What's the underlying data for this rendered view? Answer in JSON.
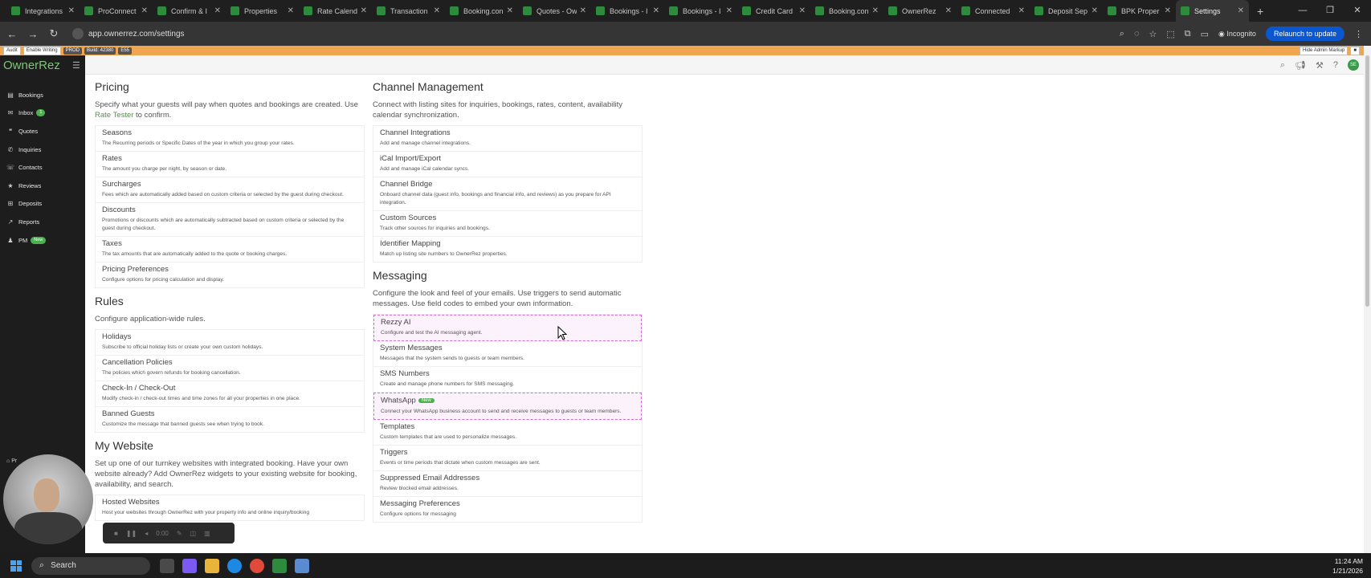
{
  "browser": {
    "tabs": [
      {
        "label": "Integrations"
      },
      {
        "label": "ProConnect"
      },
      {
        "label": "Confirm & I"
      },
      {
        "label": "Properties"
      },
      {
        "label": "Rate Calend"
      },
      {
        "label": "Transaction"
      },
      {
        "label": "Booking.con"
      },
      {
        "label": "Quotes - Ow"
      },
      {
        "label": "Bookings - I"
      },
      {
        "label": "Bookings - I"
      },
      {
        "label": "Credit Card"
      },
      {
        "label": "Booking.con"
      },
      {
        "label": "OwnerRez"
      },
      {
        "label": "Connected"
      },
      {
        "label": "Deposit Sep"
      },
      {
        "label": "BPK Proper"
      },
      {
        "label": "Settings"
      }
    ],
    "url": "app.ownerrez.com/settings",
    "incognito_label": "Incognito",
    "relaunch_label": "Relaunch to update"
  },
  "toolbar": {
    "audit_label": "Audit",
    "enable_writing_label": "Enable Writing",
    "env_badge": "PROD",
    "build_badge": "Build: 42380",
    "extra_badge": "E55",
    "hide_admin_label": "Hide Admin Markup"
  },
  "app": {
    "logo": "OwnerRez",
    "avatar_initials": "SE",
    "nav": [
      {
        "label": "Bookings",
        "icon": "book-icon"
      },
      {
        "label": "Inbox",
        "icon": "inbox-icon",
        "badge": "1"
      },
      {
        "label": "Quotes",
        "icon": "quotes-icon"
      },
      {
        "label": "Inquiries",
        "icon": "inquiries-icon"
      },
      {
        "label": "Contacts",
        "icon": "contacts-icon"
      },
      {
        "label": "Reviews",
        "icon": "star-icon"
      },
      {
        "label": "Deposits",
        "icon": "deposits-icon"
      },
      {
        "label": "Reports",
        "icon": "reports-icon"
      },
      {
        "label": "PM",
        "icon": "user-icon",
        "badge": "New"
      }
    ],
    "sidebar_bottom": "Pr"
  },
  "pricing": {
    "title": "Pricing",
    "desc_before": "Specify what your guests will pay when quotes and bookings are created. Use",
    "desc_link": "Rate Tester",
    "desc_after": "to confirm.",
    "items": [
      {
        "title": "Seasons",
        "desc": "The Recurring periods or Specific Dates of the year in which you group your rates."
      },
      {
        "title": "Rates",
        "desc": "The amount you charge per night, by season or date."
      },
      {
        "title": "Surcharges",
        "desc": "Fees which are automatically added based on custom criteria or selected by the guest during checkout."
      },
      {
        "title": "Discounts",
        "desc": "Promotions or discounts which are automatically subtracted based on custom criteria or selected by the guest during checkout."
      },
      {
        "title": "Taxes",
        "desc": "The tax amounts that are automatically added to the quote or booking charges."
      },
      {
        "title": "Pricing Preferences",
        "desc": "Configure options for pricing calculation and display."
      }
    ]
  },
  "rules": {
    "title": "Rules",
    "desc": "Configure application-wide rules.",
    "items": [
      {
        "title": "Holidays",
        "desc": "Subscribe to official holiday lists or create your own custom holidays."
      },
      {
        "title": "Cancellation Policies",
        "desc": "The policies which govern refunds for booking cancellation."
      },
      {
        "title": "Check-In / Check-Out",
        "desc": "Modify check-in / check-out times and time zones for all your properties in one place."
      },
      {
        "title": "Banned Guests",
        "desc": "Customize the message that banned guests see when trying to book."
      }
    ]
  },
  "mywebsite": {
    "title": "My Website",
    "desc": "Set up one of our turnkey websites with integrated booking. Have your own website already? Add OwnerRez widgets to your existing website for booking, availability, and search.",
    "items": [
      {
        "title": "Hosted Websites",
        "desc": "Host your websites through OwnerRez with your property info and online inquiry/booking"
      }
    ]
  },
  "channel": {
    "title": "Channel Management",
    "desc": "Connect with listing sites for inquiries, bookings, rates, content, availability calendar synchronization.",
    "items": [
      {
        "title": "Channel Integrations",
        "desc": "Add and manage channel integrations."
      },
      {
        "title": "iCal Import/Export",
        "desc": "Add and manage iCal calendar syncs."
      },
      {
        "title": "Channel Bridge",
        "desc": "Onboard channel data (guest info, bookings and financial info, and reviews) as you prepare for API integration."
      },
      {
        "title": "Custom Sources",
        "desc": "Track other sources for inquiries and bookings."
      },
      {
        "title": "Identifier Mapping",
        "desc": "Match up listing site numbers to OwnerRez properties."
      }
    ]
  },
  "messaging": {
    "title": "Messaging",
    "desc": "Configure the look and feel of your emails. Use triggers to send automatic messages. Use field codes to embed your own information.",
    "items": [
      {
        "title": "Rezzy AI",
        "desc": "Configure and test the AI messaging agent."
      },
      {
        "title": "System Messages",
        "desc": "Messages that the system sends to guests or team members."
      },
      {
        "title": "SMS Numbers",
        "desc": "Create and manage phone numbers for SMS messaging."
      },
      {
        "title": "WhatsApp",
        "badge": "New",
        "desc": "Connect your WhatsApp business account to send and receive messages to guests or team members."
      },
      {
        "title": "Templates",
        "desc": "Custom templates that are used to personalize messages."
      },
      {
        "title": "Triggers",
        "desc": "Events or time periods that dictate when custom messages are sent."
      },
      {
        "title": "Suppressed Email Addresses",
        "desc": "Review blocked email addresses."
      },
      {
        "title": "Messaging Preferences",
        "desc": "Configure options for messaging"
      }
    ]
  },
  "video": {
    "time": "0:00"
  },
  "taskbar": {
    "search_placeholder": "Search",
    "time": "11:24 AM",
    "date": "1/21/2026"
  }
}
